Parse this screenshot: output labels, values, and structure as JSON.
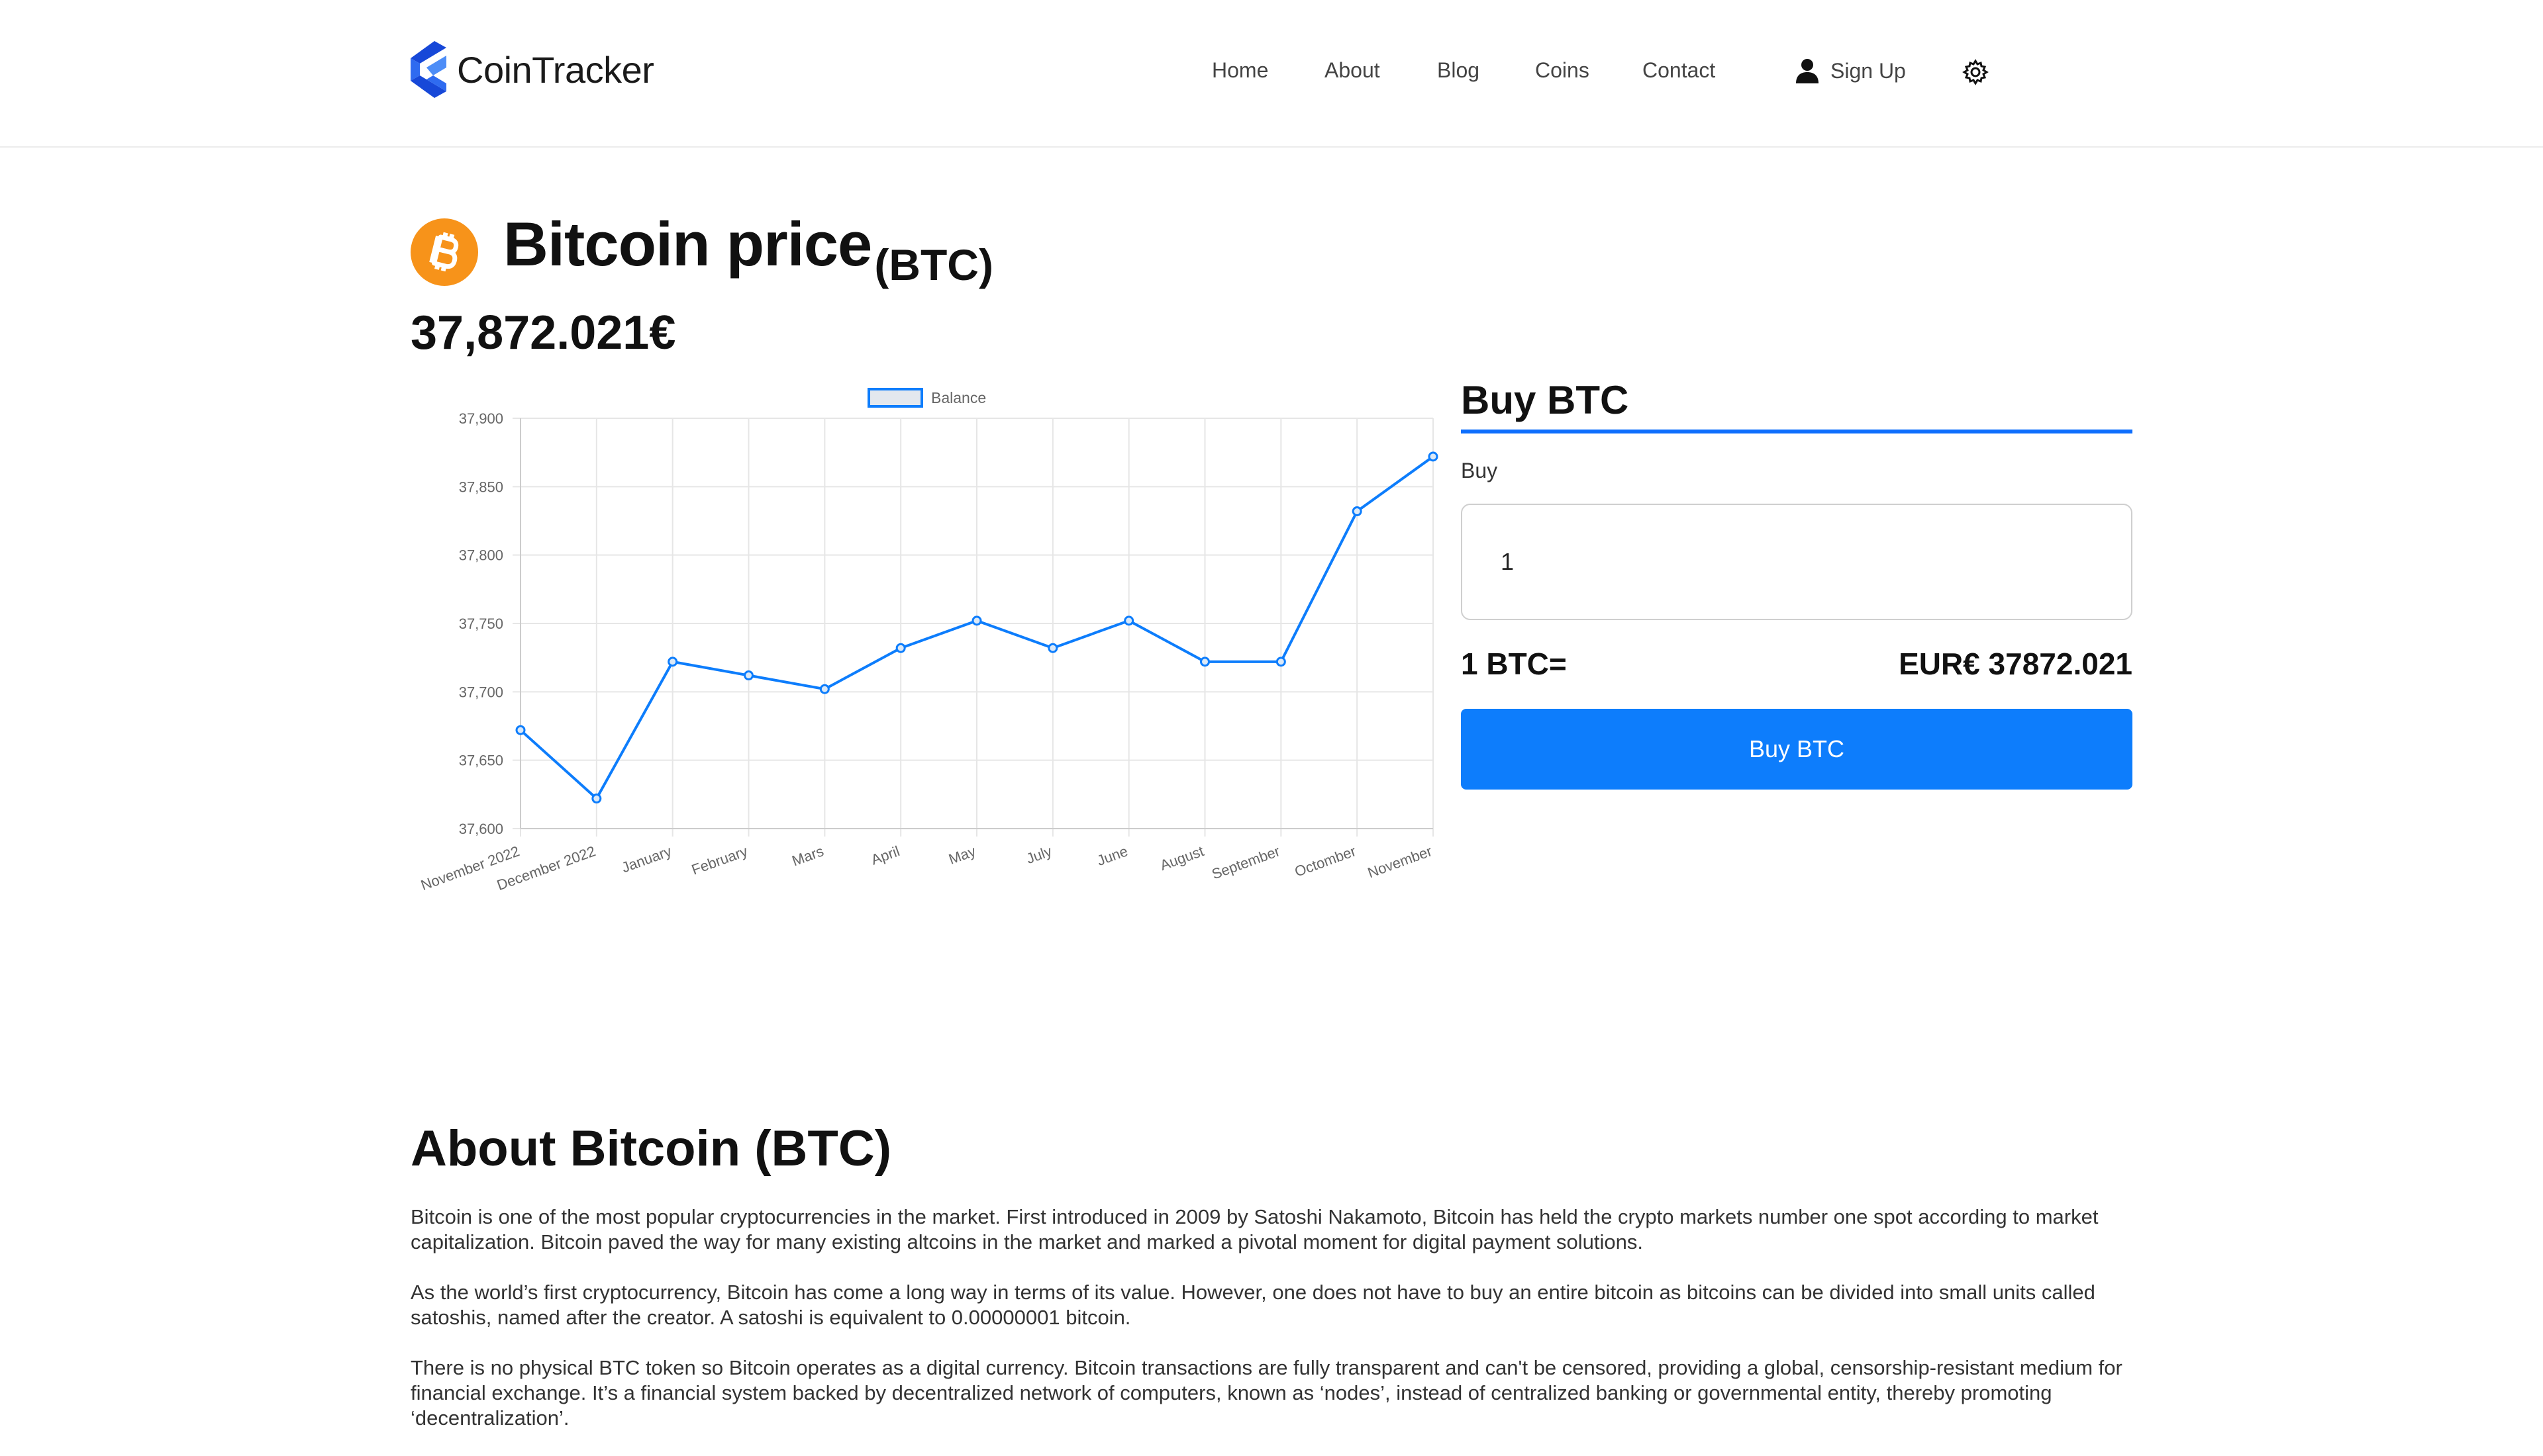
{
  "header": {
    "brand": "CoinTracker",
    "nav": [
      {
        "id": "home",
        "label": "Home"
      },
      {
        "id": "about",
        "label": "About"
      },
      {
        "id": "blog",
        "label": "Blog"
      },
      {
        "id": "coins",
        "label": "Coins"
      },
      {
        "id": "contact",
        "label": "Contact"
      }
    ],
    "signup_label": "Sign Up",
    "icons": {
      "brand": "cointracker-logo",
      "user": "user-icon",
      "settings": "gear-icon"
    }
  },
  "coin": {
    "title": "Bitcoin price",
    "symbol": "(BTC)",
    "price": "37,872.021€",
    "icon": "bitcoin-icon",
    "icon_color": "#f7931a"
  },
  "chart_data": {
    "type": "line",
    "legend": [
      "Balance"
    ],
    "legend_position": "top-center",
    "categories": [
      "November 2022",
      "December 2022",
      "January",
      "February",
      "Mars",
      "April",
      "May",
      "July",
      "June",
      "August",
      "September",
      "Octomber",
      "November"
    ],
    "series": [
      {
        "name": "Balance",
        "values": [
          37672,
          37622,
          37722,
          37712,
          37702,
          37732,
          37752,
          37732,
          37752,
          37722,
          37722,
          37832,
          37872
        ],
        "color": "#0d7dfc"
      }
    ],
    "yticks": [
      "37,900",
      "37,850",
      "37,800",
      "37,750",
      "37,700",
      "37,650",
      "37,600"
    ],
    "ylim": [
      37600,
      37900
    ],
    "grid": true
  },
  "buy": {
    "heading": "Buy BTC",
    "label": "Buy",
    "input_value": "1",
    "rate_left": "1 BTC=",
    "rate_right": "EUR€ 37872.021",
    "button": "Buy BTC",
    "accent": "#0d7dfc"
  },
  "about": {
    "heading": "About Bitcoin (BTC)",
    "paragraphs": [
      "Bitcoin is one of the most popular cryptocurrencies in the market. First introduced in 2009 by Satoshi Nakamoto, Bitcoin has held the crypto markets number one spot according to market capitalization. Bitcoin paved the way for many existing altcoins in the market and marked a pivotal moment for digital payment solutions.",
      "As the world’s first cryptocurrency, Bitcoin has come a long way in terms of its value. However, one does not have to buy an entire bitcoin as bitcoins can be divided into small units called satoshis, named after the creator. A satoshi is equivalent to 0.00000001 bitcoin.",
      "There is no physical BTC token so Bitcoin operates as a digital currency. Bitcoin transactions are fully transparent and can't be censored, providing a global, censorship-resistant medium for financial exchange. It’s a financial system backed by decentralized network of computers, known as ‘nodes’, instead of centralized banking or governmental entity, thereby promoting ‘decentralization’."
    ]
  }
}
